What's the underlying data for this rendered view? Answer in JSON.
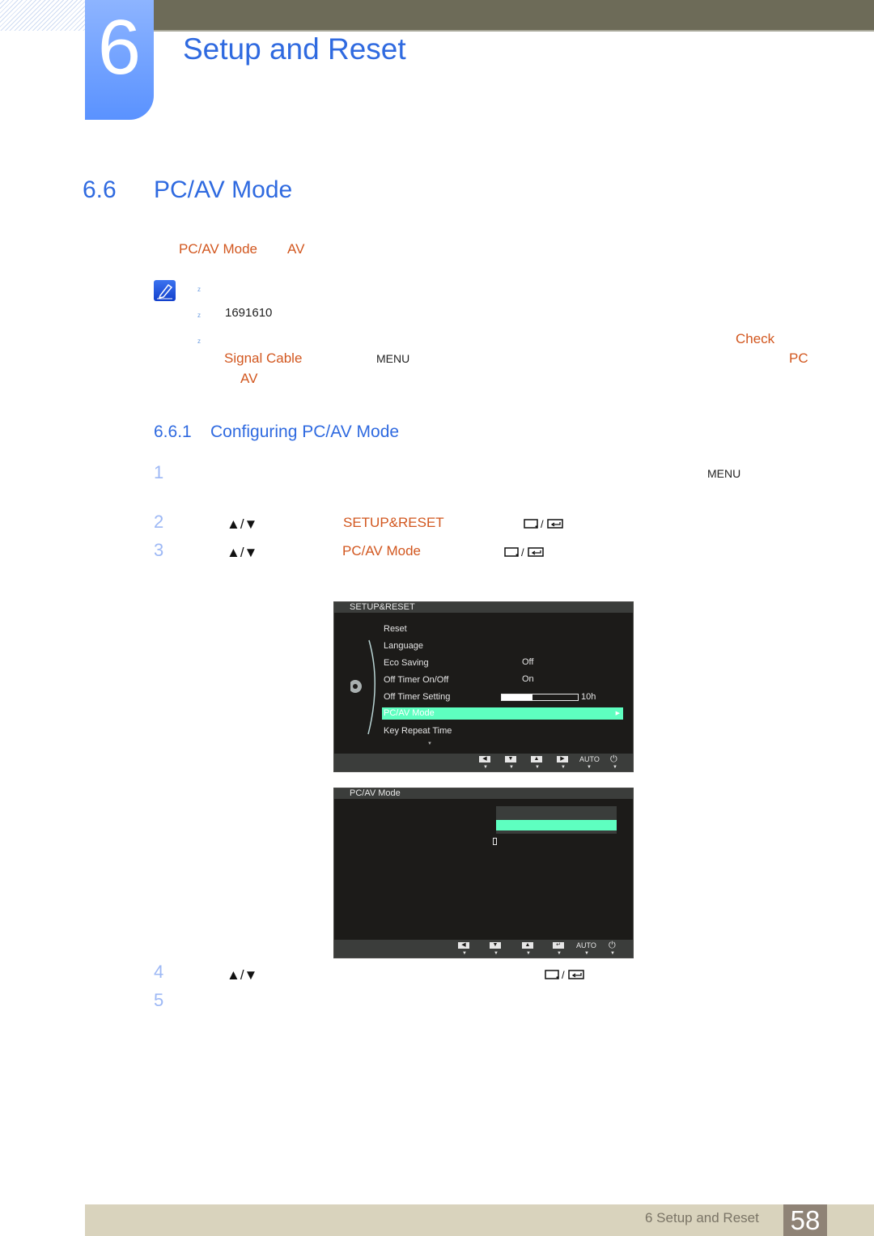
{
  "header": {
    "chapter_number": "6",
    "chapter_title": "Setup and Reset"
  },
  "section": {
    "number": "6.6",
    "title": "PC/AV Mode",
    "intro": {
      "term1": "PC/AV Mode",
      "term2": "AV"
    },
    "notes": [
      {
        "bullet": "z",
        "text": ""
      },
      {
        "bullet": "z",
        "text": "1691610"
      },
      {
        "bullet": "z",
        "check": "Check",
        "signal_cable": "Signal Cable",
        "menu": "MENU",
        "pc": "PC",
        "av": "AV"
      }
    ]
  },
  "subsection": {
    "number": "6.6.1",
    "title": "Configuring PC/AV Mode",
    "steps": [
      {
        "num": "1",
        "menu": "MENU"
      },
      {
        "num": "2",
        "arrows": "▲/▼",
        "target": "SETUP&RESET",
        "buttons": "▢/⇚"
      },
      {
        "num": "3",
        "arrows": "▲/▼",
        "target": "PC/AV Mode",
        "buttons": "▢/⇚"
      },
      {
        "num": "4",
        "arrows": "▲/▼",
        "buttons": "▢/⇚"
      },
      {
        "num": "5"
      }
    ]
  },
  "osd1": {
    "title": "SETUP&RESET",
    "items": [
      {
        "label": "Reset",
        "value": ""
      },
      {
        "label": "Language",
        "value": ""
      },
      {
        "label": "Eco Saving",
        "value": "Off"
      },
      {
        "label": "Off Timer On/Off",
        "value": "On"
      },
      {
        "label": "Off Timer Setting",
        "value": "10h",
        "progress": 0.4
      },
      {
        "label": "PC/AV Mode",
        "value": "",
        "selected": true
      },
      {
        "label": "Key Repeat Time",
        "value": ""
      }
    ],
    "footer_buttons": [
      "◀",
      "▼",
      "▲",
      "▶",
      "AUTO",
      "⏻"
    ]
  },
  "osd2": {
    "title": "PC/AV Mode",
    "footer_buttons": [
      "◀",
      "▼",
      "▲",
      "↵",
      "AUTO",
      "⏻"
    ]
  },
  "footer": {
    "text": "6 Setup and Reset",
    "page": "58"
  },
  "colors": {
    "accent_blue": "#2f6ae0",
    "accent_orange": "#d2571f",
    "osd_highlight": "#5effc0"
  }
}
